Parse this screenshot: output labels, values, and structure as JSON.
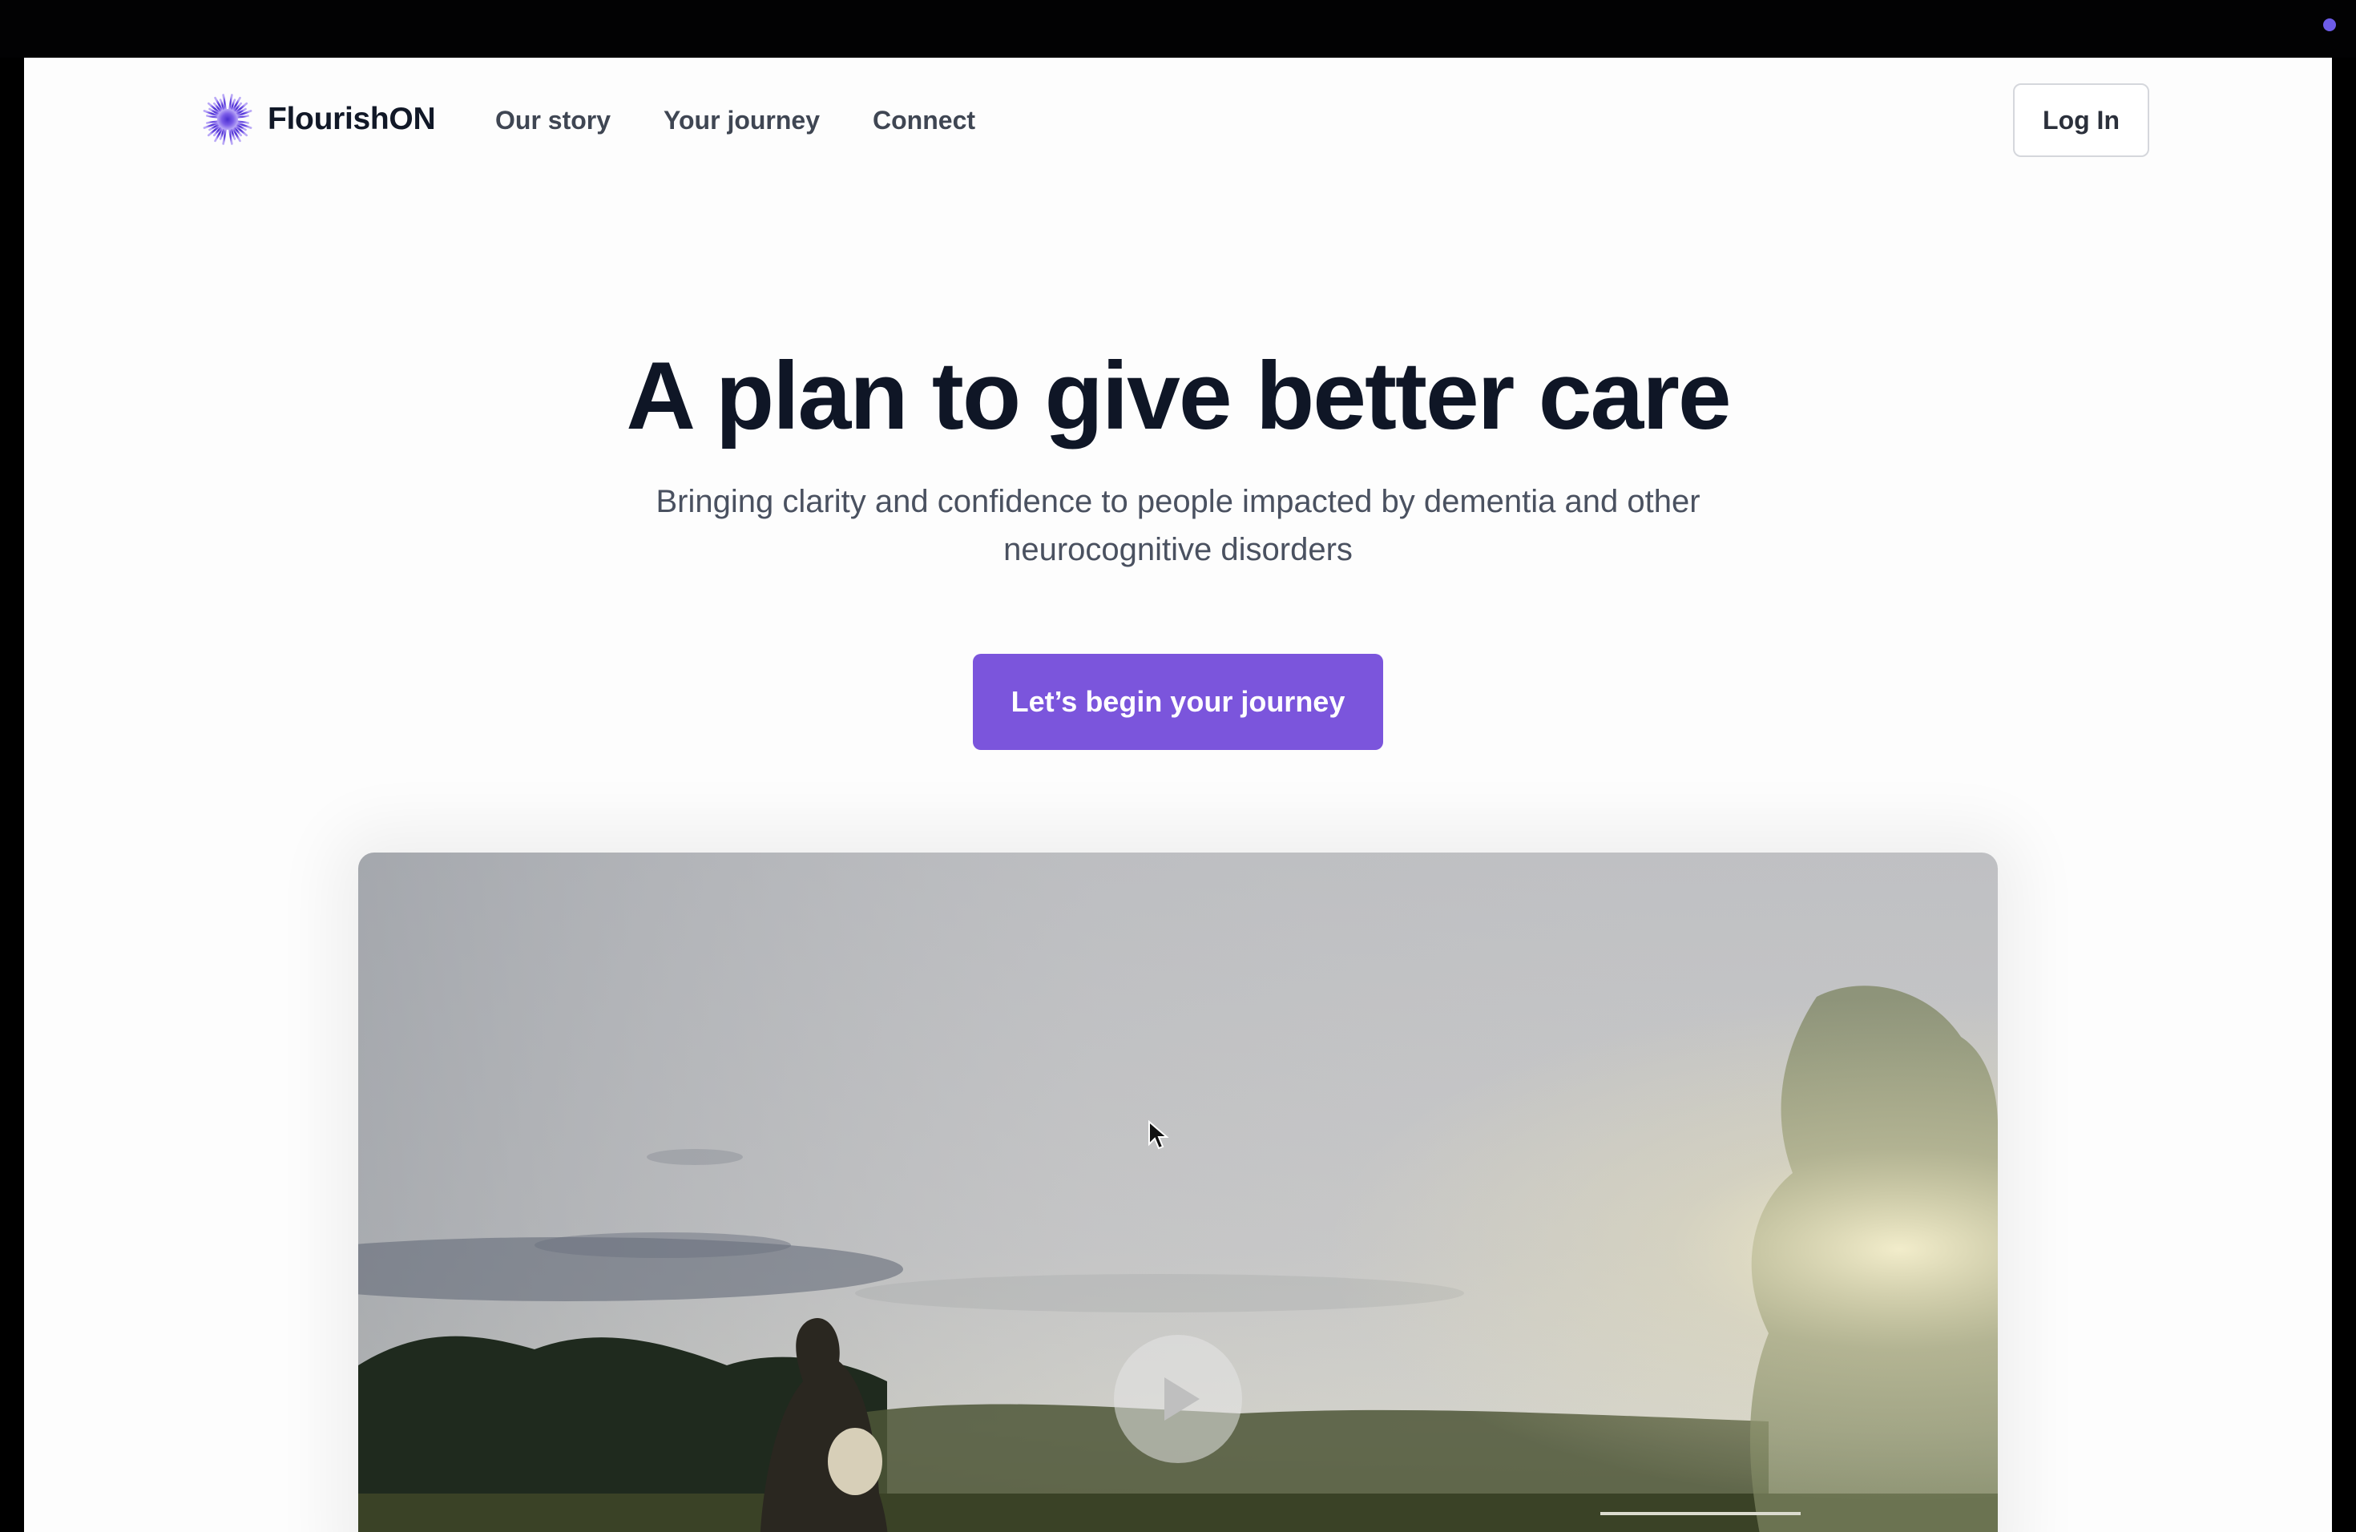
{
  "brand": {
    "name": "FlourishON",
    "logo_icon": "burst-logo-icon",
    "accent": "#7b55dc"
  },
  "nav": {
    "items": [
      "Our story",
      "Your journey",
      "Connect"
    ]
  },
  "header": {
    "login_label": "Log In"
  },
  "hero": {
    "title": "A plan to give better care",
    "subtitle": "Bringing clarity and confidence to people impacted by dementia and other neurocognitive disorders",
    "cta_label": "Let’s begin your journey"
  },
  "video": {
    "play_icon": "play-icon"
  }
}
